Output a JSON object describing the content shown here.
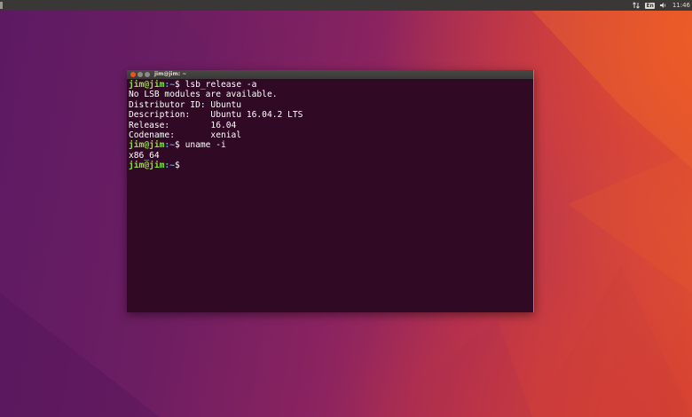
{
  "topbar": {
    "tray": {
      "network_icon": "network-updown-icon",
      "keyboard_label": "En",
      "volume_icon": "speaker-icon",
      "clock": "11:46"
    }
  },
  "terminal": {
    "window_title": "jim@jim: ~",
    "lines": [
      {
        "user": "jim@jim",
        "path": ":~",
        "prompt_end": "$ ",
        "command": "lsb_release -a"
      },
      {
        "output": "No LSB modules are available."
      },
      {
        "output": "Distributor ID:\tUbuntu"
      },
      {
        "output": "Description:\tUbuntu 16.04.2 LTS"
      },
      {
        "output": "Release:\t16.04"
      },
      {
        "output": "Codename:\txenial"
      },
      {
        "user": "jim@jim",
        "path": ":~",
        "prompt_end": "$ ",
        "command": "uname -i"
      },
      {
        "output": "x86_64"
      },
      {
        "user": "jim@jim",
        "path": ":~",
        "prompt_end": "$ ",
        "command": ""
      }
    ]
  },
  "colors": {
    "terminal_bg": "#300a24",
    "prompt_user": "#8ae234",
    "prompt_path": "#729fcf",
    "accent": "#e95420"
  }
}
